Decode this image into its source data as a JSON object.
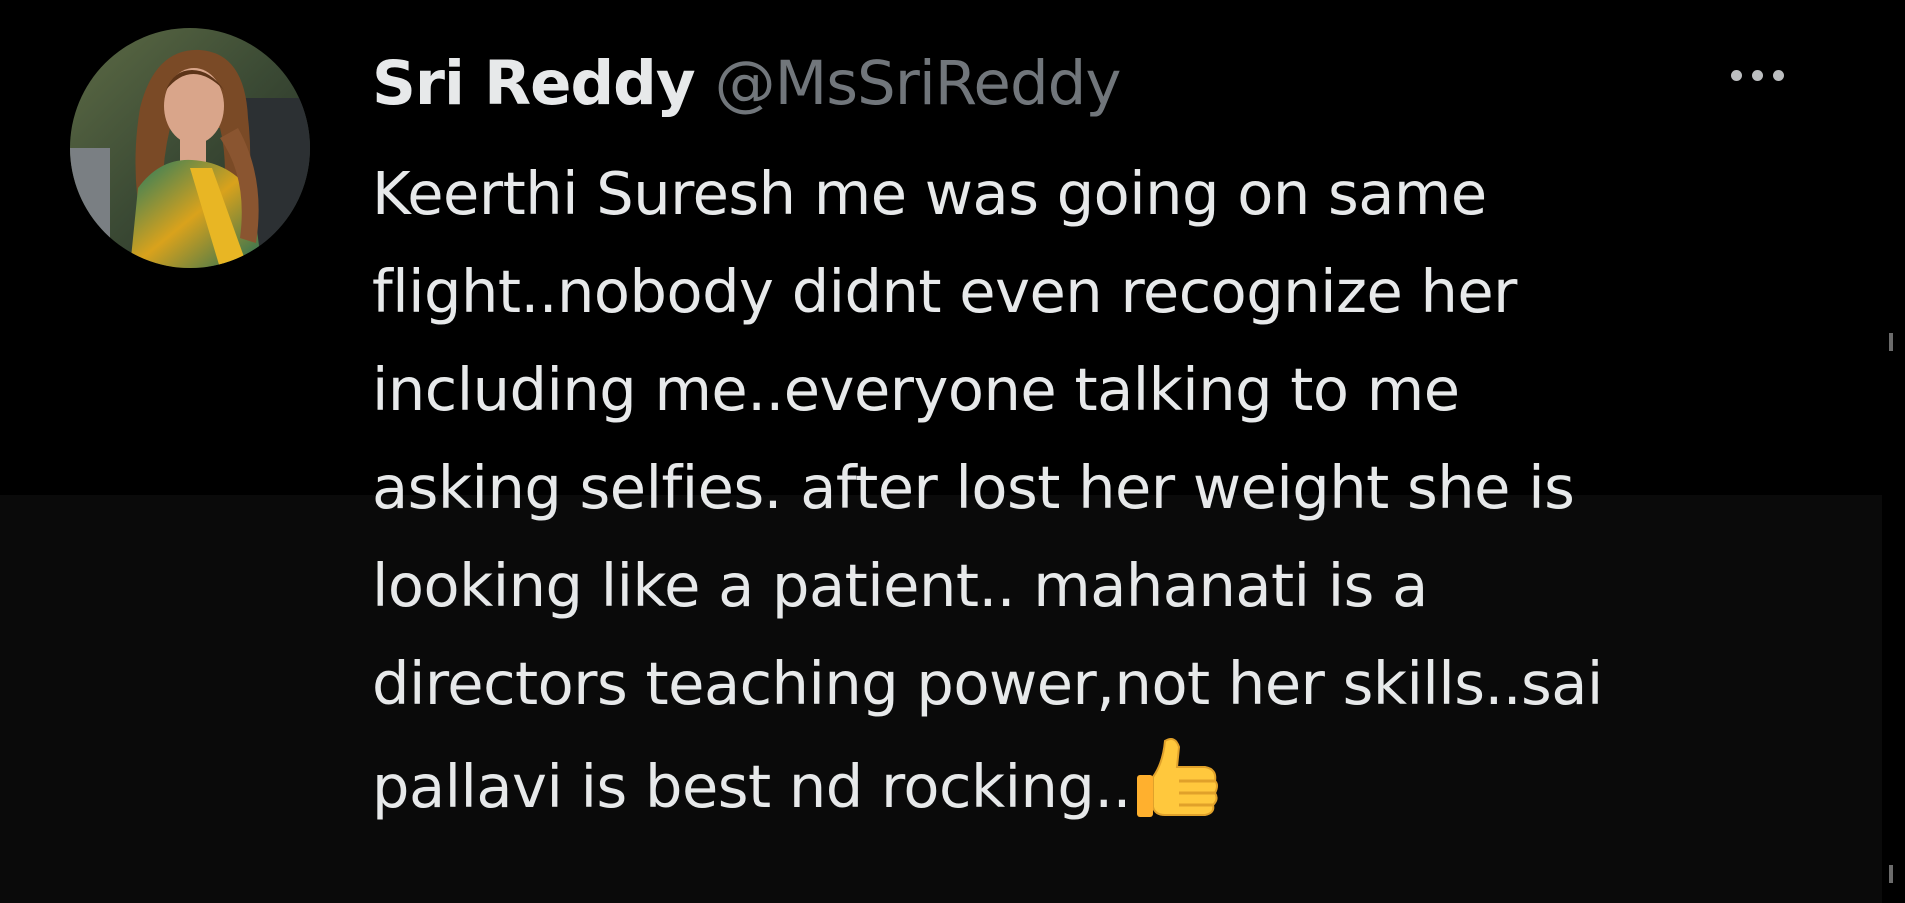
{
  "tweet": {
    "author": {
      "display_name": "Sri Reddy",
      "handle": "@MsSriReddy",
      "avatar_icon": "profile-photo"
    },
    "more_icon": "more-horizontal-icon",
    "text_lines": [
      "Keerthi Suresh me was going on same",
      "flight..nobody didnt even recognize her",
      "including me..everyone talking to me",
      "asking selfies. after lost her weight she is",
      "looking like a patient.. mahanati is a",
      "directors teaching power,not her skills..sai",
      "pallavi is best nd rocking.."
    ],
    "trailing_emoji": "thumbs-up-icon"
  },
  "colors": {
    "background": "#000000",
    "lower_band": "#0a0a0a",
    "text_primary": "#e7e9ea",
    "text_secondary": "#71767b"
  }
}
